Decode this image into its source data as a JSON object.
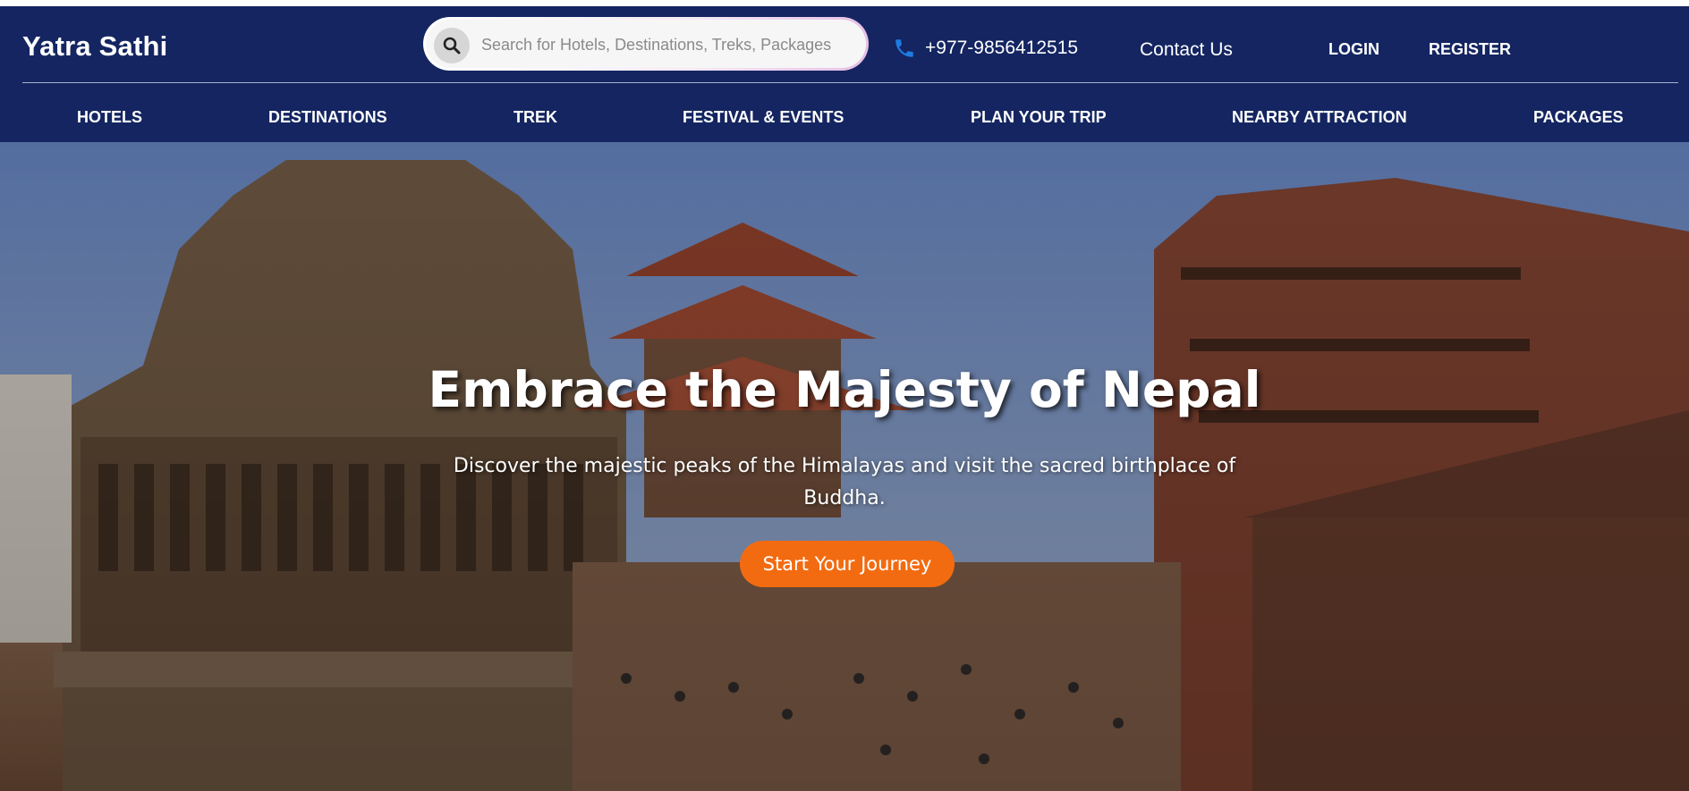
{
  "brand": {
    "name": "Yatra Sathi"
  },
  "search": {
    "placeholder": "Search for Hotels, Destinations, Treks, Packages",
    "value": ""
  },
  "contact": {
    "phone": "+977-9856412515",
    "contact_label": "Contact Us"
  },
  "auth": {
    "login": "LOGIN",
    "register": "REGISTER"
  },
  "nav": {
    "items": [
      {
        "label": "HOTELS"
      },
      {
        "label": "DESTINATIONS"
      },
      {
        "label": "TREK"
      },
      {
        "label": "FESTIVAL & EVENTS"
      },
      {
        "label": "PLAN YOUR TRIP"
      },
      {
        "label": "NEARBY ATTRACTION"
      },
      {
        "label": "PACKAGES"
      }
    ]
  },
  "hero": {
    "title": "Embrace the Majesty of Nepal",
    "subtitle": "Discover the majestic peaks of the Himalayas and visit the sacred birthplace of Buddha.",
    "cta": "Start Your Journey"
  },
  "colors": {
    "header_bg": "#142561",
    "cta_bg": "#f36b10",
    "phone_icon": "#1e7be0"
  },
  "icons": {
    "search": "search-icon",
    "phone": "phone-icon"
  }
}
